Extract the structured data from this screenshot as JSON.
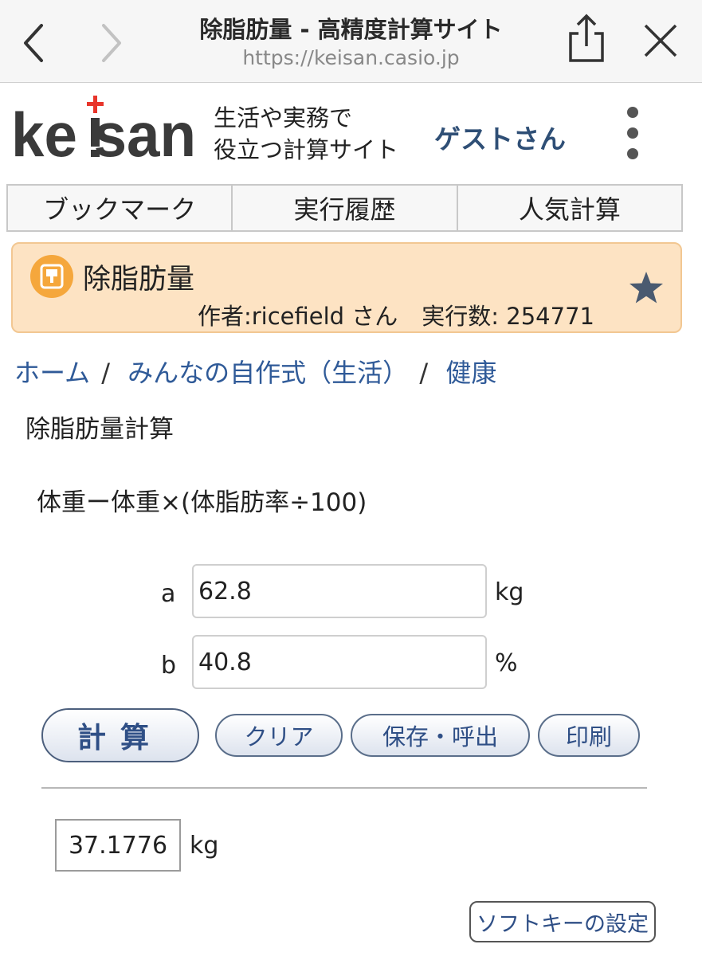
{
  "browser": {
    "page_title": "除脂肪量 - 高精度計算サイト",
    "url": "https://keisan.casio.jp"
  },
  "header": {
    "logo_text": "keisan",
    "tagline_line1": "生活や実務で",
    "tagline_line2": "役立つ計算サイト",
    "user": "ゲストさん"
  },
  "tabs": [
    {
      "label": "ブックマーク"
    },
    {
      "label": "実行履歴"
    },
    {
      "label": "人気計算"
    }
  ],
  "card": {
    "title": "除脂肪量",
    "author": "作者:ricefield さん",
    "run_count": "実行数: 254771"
  },
  "breadcrumb": {
    "home": "ホーム",
    "category": "みんなの自作式（生活）",
    "subcategory": "健康"
  },
  "calculator": {
    "title": "除脂肪量計算",
    "formula": "体重ー体重×(体脂肪率÷100)",
    "inputs": [
      {
        "label": "a",
        "value": "62.8",
        "unit": "kg"
      },
      {
        "label": "b",
        "value": "40.8",
        "unit": "%"
      }
    ],
    "buttons": {
      "calculate": "計算",
      "clear": "クリア",
      "save_load": "保存・呼出",
      "print": "印刷"
    },
    "result": {
      "value": "37.1776",
      "unit": "kg"
    },
    "softkey_label": "ソフトキーの設定"
  },
  "colors": {
    "card_bg": "#fde3c3",
    "link": "#2f5a98",
    "button_text": "#2f4f86",
    "logo_cross": "#e8352b"
  }
}
